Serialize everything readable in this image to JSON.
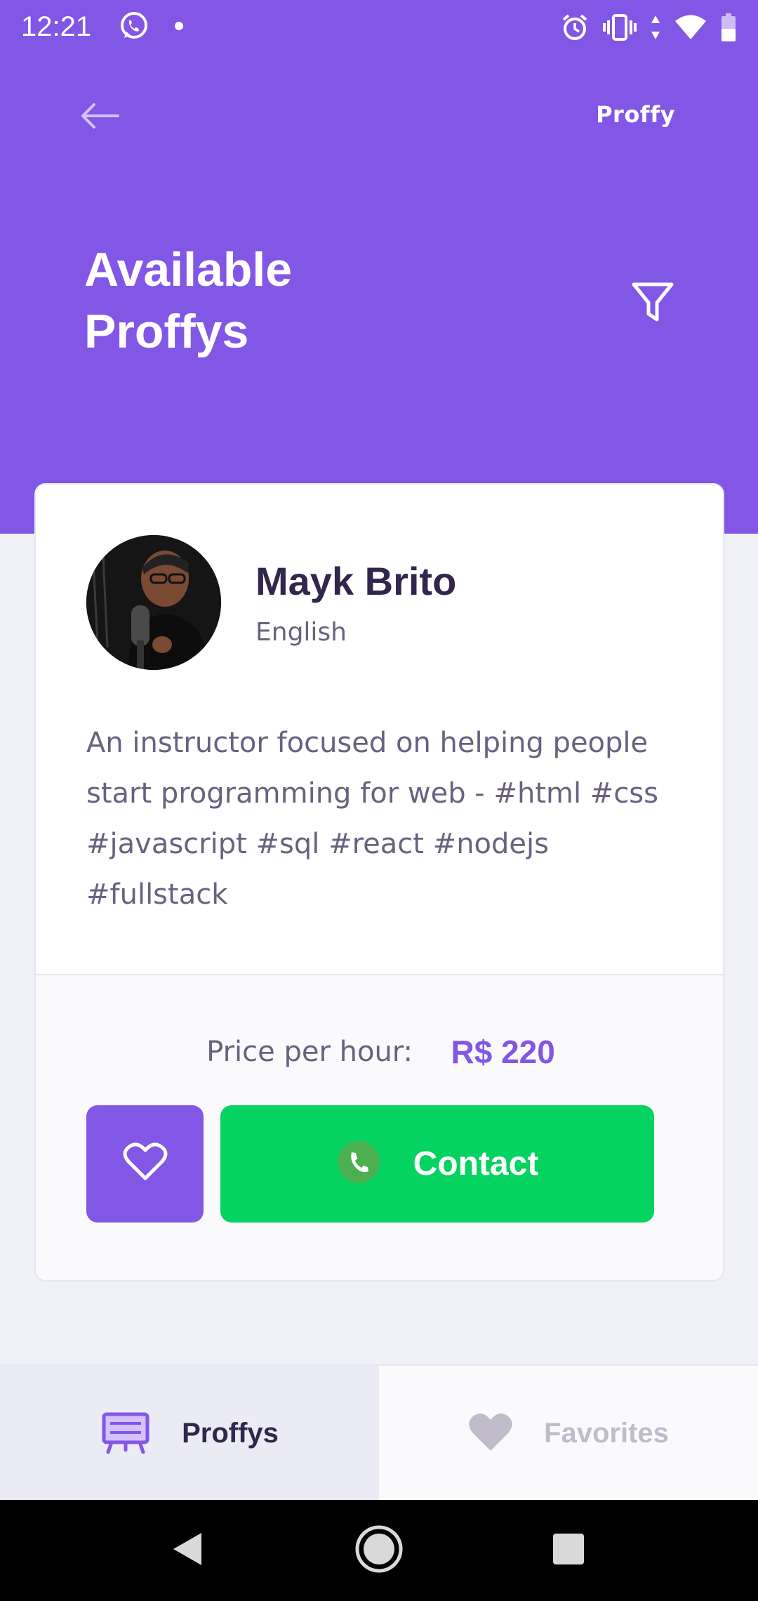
{
  "status_bar": {
    "time": "12:21",
    "icons_left": [
      "whatsapp-icon",
      "dot-icon"
    ],
    "icons_right": [
      "alarm-icon",
      "vibrate-icon",
      "data-arrows-icon",
      "wifi-icon",
      "battery-icon"
    ]
  },
  "header": {
    "back_icon": "arrow-left-icon",
    "brand": "Proffy",
    "title_line1": "Available",
    "title_line2": "Proffys",
    "filter_icon": "filter-icon"
  },
  "teacher": {
    "name": "Mayk Brito",
    "subject": "English",
    "bio": "An instructor focused on helping people start programming for web - #html #css #javascript #sql #react #nodejs #fullstack",
    "price_label": "Price per hour:",
    "price_value": "R$ 220",
    "contact_label": "Contact"
  },
  "tabs": [
    {
      "label": "Proffys",
      "icon": "easel-icon",
      "active": true
    },
    {
      "label": "Favorites",
      "icon": "heart-icon",
      "active": false
    }
  ],
  "colors": {
    "primary": "#8257E5",
    "background": "#F0F0F7",
    "title_text": "#32264D",
    "body_text": "#6A6180",
    "secondary": "#04D361",
    "inactive": "#C1BCCC"
  }
}
